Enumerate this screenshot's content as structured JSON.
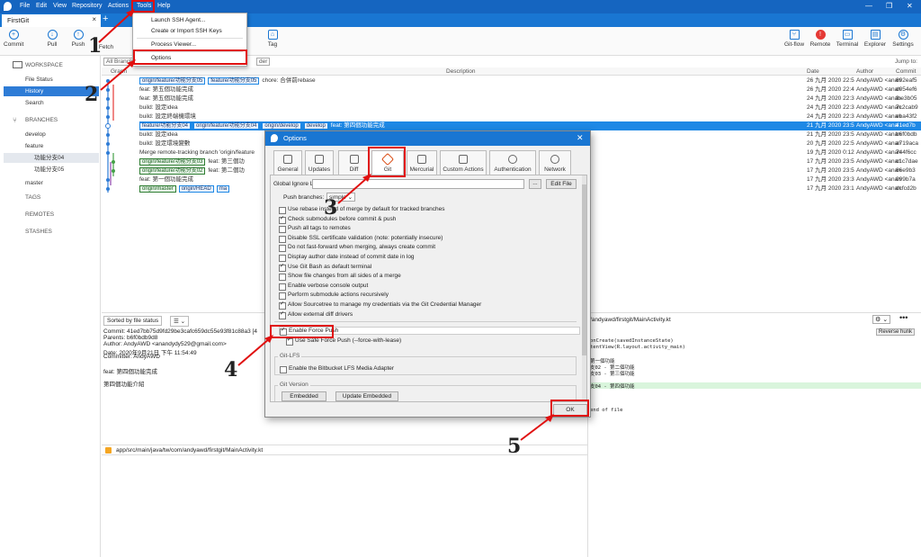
{
  "menubar": [
    "File",
    "Edit",
    "View",
    "Repository",
    "Actions",
    "Tools",
    "Help"
  ],
  "tab": {
    "name": "FirstGit",
    "close": "×",
    "add": "+"
  },
  "toolbar": {
    "left": [
      "Commit",
      "Pull",
      "Push",
      "Fetch",
      "",
      "Tag"
    ],
    "right": [
      "Git-flow",
      "Remote",
      "Terminal",
      "Explorer",
      "Settings"
    ]
  },
  "tools_menu": [
    "Launch SSH Agent...",
    "Create or Import SSH Keys",
    "Process Viewer...",
    "Options"
  ],
  "sidebar": {
    "workspace": "WORKSPACE",
    "workspace_items": [
      "File Status",
      "History",
      "Search"
    ],
    "branches": "BRANCHES",
    "branch_items": [
      "develop",
      "feature",
      "功能分支04",
      "功能分支05",
      "master"
    ],
    "tags": "TAGS",
    "remotes": "REMOTES",
    "stashes": "STASHES"
  },
  "graph_header": {
    "branches": "All Branches",
    "order": "der",
    "graph": "Graph",
    "description": "Description",
    "date": "Date",
    "author": "Author",
    "commit": "Commit",
    "jump": "Jump to:"
  },
  "commits": [
    {
      "tags": [
        "origin/feature/功能分支05",
        "feature/功能分支05"
      ],
      "msg": "chore: 合併前rebase",
      "date": "26 九月 2020 22:5",
      "author": "AndyAWD <anan",
      "hash": "692eaf5"
    },
    {
      "tags": [],
      "msg": "feat: 第五個功能完成",
      "date": "26 九月 2020 22:4",
      "author": "AndyAWD <anan",
      "hash": "d054ef6"
    },
    {
      "tags": [],
      "msg": "feat: 第五個功能完成",
      "date": "24 九月 2020 22:3",
      "author": "AndyAWD <anan",
      "hash": "fbe3b05"
    },
    {
      "tags": [],
      "msg": "build: 設定idea",
      "date": "24 九月 2020 22:3",
      "author": "AndyAWD <anan",
      "hash": "7c2cab9"
    },
    {
      "tags": [],
      "msg": "build: 設定終端機環境",
      "date": "24 九月 2020 22:3",
      "author": "AndyAWD <anan",
      "hash": "eba43f2"
    },
    {
      "tags": [
        "feature/功能分支04",
        "origin/feature/功能分支04",
        "origin/develop",
        "develop"
      ],
      "msg": "feat: 第四個功能完成",
      "date": "21 九月 2020 23:5",
      "author": "AndyAWD <ana",
      "hash": "41ed7b"
    },
    {
      "tags": [],
      "msg": "build: 設定idea",
      "date": "21 九月 2020 23:5",
      "author": "AndyAWD <anan",
      "hash": "b6f0bdb"
    },
    {
      "tags": [],
      "msg": "build: 設定環境變數",
      "date": "20 九月 2020 22:5",
      "author": "AndyAWD <anan",
      "hash": "a719aca"
    },
    {
      "tags": [],
      "msg": "Merge remote-tracking branch 'origin/feature",
      "date": "19 九月 2020 0:12",
      "author": "AndyAWD <anan",
      "hash": "744f6cc"
    },
    {
      "tags": [
        "origin/feature/功能分支03"
      ],
      "msg": "feat: 第三個功",
      "date": "17 九月 2020 23:5",
      "author": "AndyAWD <anan",
      "hash": "c1c7dae"
    },
    {
      "tags": [
        "origin/feature/功能分支02"
      ],
      "msg": "feat: 第二個功",
      "date": "17 九月 2020 23:5",
      "author": "AndyAWD <anan",
      "hash": "66e9b3"
    },
    {
      "tags": [],
      "msg": "feat: 第一個功能完成",
      "date": "17 九月 2020 23:3",
      "author": "AndyAWD <anan",
      "hash": "099b7a"
    },
    {
      "tags": [
        "origin/master",
        "origin/HEAD",
        "ma"
      ],
      "msg": "",
      "date": "17 九月 2020 23:1",
      "author": "AndyAWD <anan",
      "hash": "dcfcd2b"
    }
  ],
  "lower_left": {
    "sort": "Sorted by file status",
    "commit": "Commit: 41ed7bb75d9fd29be3cafc659dc55e93f81c88a3 [4",
    "parents": "Parents: b6f0bdb9d8",
    "author": "Author: AndyAWD <anandydy529@gmail.com>",
    "date": "Date: 2020年9月21日 下午 11:54:49",
    "committer": "Committer: AndyAWD",
    "msg1": "feat: 第四個功能完成",
    "msg2": "第四個功能介紹",
    "file": "app/src/main/java/tw/com/andyawd/firstgit/MainActivity.kt"
  },
  "lower_right": {
    "path": "/andyawd/firstgit/MainActivity.kt",
    "reverse": "Reverse hunk",
    "code": [
      "onCreate(savedInstanceState)",
      "tentView(R.layout.activity_main)",
      "",
      "第一個功能",
      "支02 - 第二個功能",
      "支03 - 第三個功能",
      "",
      "支04 - 第四個功能",
      "",
      "",
      "",
      "end of file"
    ]
  },
  "dialog": {
    "title": "Options",
    "tabs": [
      "General",
      "Updates",
      "Diff",
      "Git",
      "Mercurial",
      "Custom Actions",
      "Authentication",
      "Network"
    ],
    "global_ignore": "Global Ignore List:",
    "browse": "...",
    "edit_file": "Edit File",
    "push_branches": "Push branches:",
    "push_value": "simple",
    "options": [
      {
        "label": "Use rebase instead of merge by default for tracked branches",
        "checked": false
      },
      {
        "label": "Check submodules before commit & push",
        "checked": true
      },
      {
        "label": "Push all tags to remotes",
        "checked": false
      },
      {
        "label": "Disable SSL certificate validation (note: potentially insecure)",
        "checked": false
      },
      {
        "label": "Do not fast-forward when merging, always create commit",
        "checked": false
      },
      {
        "label": "Display author date instead of commit date in log",
        "checked": false
      },
      {
        "label": "Use Git Bash as default terminal",
        "checked": true
      },
      {
        "label": "Show file changes from all sides of a merge",
        "checked": false
      },
      {
        "label": "Enable verbose console output",
        "checked": false
      },
      {
        "label": "Perform submodule actions recursively",
        "checked": false
      },
      {
        "label": "Allow Sourcetree to manage my credentials via the Git Credential Manager",
        "checked": true
      },
      {
        "label": "Allow external diff drivers",
        "checked": true
      }
    ],
    "force_push": "Enable Force Push",
    "safe_force": "Use Safe Force Push (--force-with-lease)",
    "lfs_group": "Git-LFS",
    "lfs_option": "Enable the Bitbucket LFS Media Adapter",
    "version_group": "Git Version",
    "embedded": "Embedded",
    "update_embedded": "Update Embedded",
    "ok": "OK"
  },
  "annotations": [
    "1",
    "2",
    "3",
    "4",
    "5"
  ],
  "colors": {
    "accent": "#1976d2",
    "highlight": "#e01010",
    "selected_row": "#1e88e5"
  }
}
